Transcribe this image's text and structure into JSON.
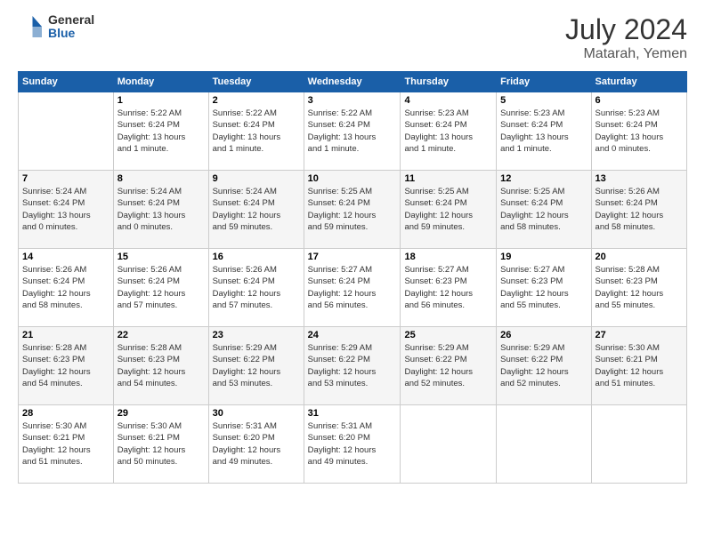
{
  "logo": {
    "general": "General",
    "blue": "Blue"
  },
  "title": {
    "month_year": "July 2024",
    "location": "Matarah, Yemen"
  },
  "days_header": [
    "Sunday",
    "Monday",
    "Tuesday",
    "Wednesday",
    "Thursday",
    "Friday",
    "Saturday"
  ],
  "weeks": [
    [
      {
        "day": "",
        "info": ""
      },
      {
        "day": "1",
        "info": "Sunrise: 5:22 AM\nSunset: 6:24 PM\nDaylight: 13 hours\nand 1 minute."
      },
      {
        "day": "2",
        "info": "Sunrise: 5:22 AM\nSunset: 6:24 PM\nDaylight: 13 hours\nand 1 minute."
      },
      {
        "day": "3",
        "info": "Sunrise: 5:22 AM\nSunset: 6:24 PM\nDaylight: 13 hours\nand 1 minute."
      },
      {
        "day": "4",
        "info": "Sunrise: 5:23 AM\nSunset: 6:24 PM\nDaylight: 13 hours\nand 1 minute."
      },
      {
        "day": "5",
        "info": "Sunrise: 5:23 AM\nSunset: 6:24 PM\nDaylight: 13 hours\nand 1 minute."
      },
      {
        "day": "6",
        "info": "Sunrise: 5:23 AM\nSunset: 6:24 PM\nDaylight: 13 hours\nand 0 minutes."
      }
    ],
    [
      {
        "day": "7",
        "info": "Sunrise: 5:24 AM\nSunset: 6:24 PM\nDaylight: 13 hours\nand 0 minutes."
      },
      {
        "day": "8",
        "info": "Sunrise: 5:24 AM\nSunset: 6:24 PM\nDaylight: 13 hours\nand 0 minutes."
      },
      {
        "day": "9",
        "info": "Sunrise: 5:24 AM\nSunset: 6:24 PM\nDaylight: 12 hours\nand 59 minutes."
      },
      {
        "day": "10",
        "info": "Sunrise: 5:25 AM\nSunset: 6:24 PM\nDaylight: 12 hours\nand 59 minutes."
      },
      {
        "day": "11",
        "info": "Sunrise: 5:25 AM\nSunset: 6:24 PM\nDaylight: 12 hours\nand 59 minutes."
      },
      {
        "day": "12",
        "info": "Sunrise: 5:25 AM\nSunset: 6:24 PM\nDaylight: 12 hours\nand 58 minutes."
      },
      {
        "day": "13",
        "info": "Sunrise: 5:26 AM\nSunset: 6:24 PM\nDaylight: 12 hours\nand 58 minutes."
      }
    ],
    [
      {
        "day": "14",
        "info": "Sunrise: 5:26 AM\nSunset: 6:24 PM\nDaylight: 12 hours\nand 58 minutes."
      },
      {
        "day": "15",
        "info": "Sunrise: 5:26 AM\nSunset: 6:24 PM\nDaylight: 12 hours\nand 57 minutes."
      },
      {
        "day": "16",
        "info": "Sunrise: 5:26 AM\nSunset: 6:24 PM\nDaylight: 12 hours\nand 57 minutes."
      },
      {
        "day": "17",
        "info": "Sunrise: 5:27 AM\nSunset: 6:24 PM\nDaylight: 12 hours\nand 56 minutes."
      },
      {
        "day": "18",
        "info": "Sunrise: 5:27 AM\nSunset: 6:23 PM\nDaylight: 12 hours\nand 56 minutes."
      },
      {
        "day": "19",
        "info": "Sunrise: 5:27 AM\nSunset: 6:23 PM\nDaylight: 12 hours\nand 55 minutes."
      },
      {
        "day": "20",
        "info": "Sunrise: 5:28 AM\nSunset: 6:23 PM\nDaylight: 12 hours\nand 55 minutes."
      }
    ],
    [
      {
        "day": "21",
        "info": "Sunrise: 5:28 AM\nSunset: 6:23 PM\nDaylight: 12 hours\nand 54 minutes."
      },
      {
        "day": "22",
        "info": "Sunrise: 5:28 AM\nSunset: 6:23 PM\nDaylight: 12 hours\nand 54 minutes."
      },
      {
        "day": "23",
        "info": "Sunrise: 5:29 AM\nSunset: 6:22 PM\nDaylight: 12 hours\nand 53 minutes."
      },
      {
        "day": "24",
        "info": "Sunrise: 5:29 AM\nSunset: 6:22 PM\nDaylight: 12 hours\nand 53 minutes."
      },
      {
        "day": "25",
        "info": "Sunrise: 5:29 AM\nSunset: 6:22 PM\nDaylight: 12 hours\nand 52 minutes."
      },
      {
        "day": "26",
        "info": "Sunrise: 5:29 AM\nSunset: 6:22 PM\nDaylight: 12 hours\nand 52 minutes."
      },
      {
        "day": "27",
        "info": "Sunrise: 5:30 AM\nSunset: 6:21 PM\nDaylight: 12 hours\nand 51 minutes."
      }
    ],
    [
      {
        "day": "28",
        "info": "Sunrise: 5:30 AM\nSunset: 6:21 PM\nDaylight: 12 hours\nand 51 minutes."
      },
      {
        "day": "29",
        "info": "Sunrise: 5:30 AM\nSunset: 6:21 PM\nDaylight: 12 hours\nand 50 minutes."
      },
      {
        "day": "30",
        "info": "Sunrise: 5:31 AM\nSunset: 6:20 PM\nDaylight: 12 hours\nand 49 minutes."
      },
      {
        "day": "31",
        "info": "Sunrise: 5:31 AM\nSunset: 6:20 PM\nDaylight: 12 hours\nand 49 minutes."
      },
      {
        "day": "",
        "info": ""
      },
      {
        "day": "",
        "info": ""
      },
      {
        "day": "",
        "info": ""
      }
    ]
  ]
}
